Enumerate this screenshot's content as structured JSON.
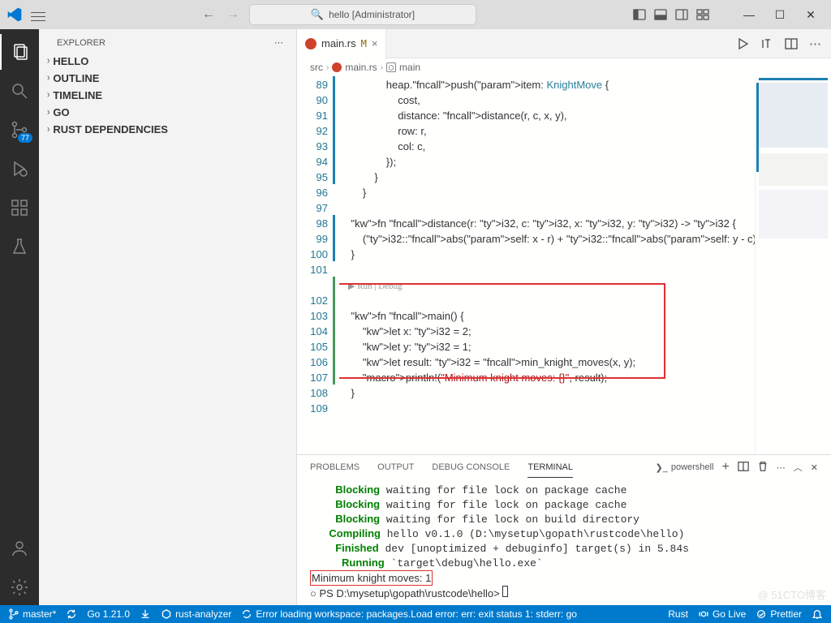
{
  "window": {
    "title": "hello [Administrator]"
  },
  "explorer": {
    "title": "EXPLORER",
    "sections": [
      "HELLO",
      "OUTLINE",
      "TIMELINE",
      "GO",
      "RUST DEPENDENCIES"
    ]
  },
  "source_control": {
    "badge": "77"
  },
  "tab": {
    "filename": "main.rs",
    "dirty_marker": "M",
    "close": "×"
  },
  "breadcrumbs": {
    "src": "src",
    "file": "main.rs",
    "symbol": "main"
  },
  "run_lens": "▶ Run | Debug",
  "code": {
    "first_line_no": 89,
    "lines": [
      "                heap.push(item: KnightMove {",
      "                    cost,",
      "                    distance: distance(r, c, x, y),",
      "                    row: r,",
      "                    col: c,",
      "                });",
      "            }",
      "        }",
      "",
      "    fn distance(r: i32, c: i32, x: i32, y: i32) -> i32 {",
      "        (i32::abs(self: x - r) + i32::abs(self: y - c)) / 3",
      "    }",
      "",
      "",
      "    fn main() {",
      "        let x: i32 = 2;",
      "        let y: i32 = 1;",
      "        let result: i32 = min_knight_moves(x, y);",
      "        println!(\"Minimum knight moves: {}\", result);",
      "    }",
      ""
    ]
  },
  "panel": {
    "tabs": {
      "problems": "PROBLEMS",
      "output": "OUTPUT",
      "debug": "DEBUG CONSOLE",
      "terminal": "TERMINAL"
    },
    "shell": "powershell"
  },
  "terminal": {
    "lines": [
      {
        "cls": "tgreen",
        "indent": "    ",
        "label": "Blocking",
        "rest": " waiting for file lock on package cache"
      },
      {
        "cls": "tgreen",
        "indent": "    ",
        "label": "Blocking",
        "rest": " waiting for file lock on package cache"
      },
      {
        "cls": "tgreen",
        "indent": "    ",
        "label": "Blocking",
        "rest": " waiting for file lock on build directory"
      },
      {
        "cls": "tgreen",
        "indent": "   ",
        "label": "Compiling",
        "rest": " hello v0.1.0 (D:\\mysetup\\gopath\\rustcode\\hello)"
      },
      {
        "cls": "tgreen",
        "indent": "    ",
        "label": "Finished",
        "rest": " dev [unoptimized + debuginfo] target(s) in 5.84s"
      },
      {
        "cls": "tgreen",
        "indent": "     ",
        "label": "Running",
        "rest": " `target\\debug\\hello.exe`"
      }
    ],
    "output": "Minimum knight moves: 1",
    "prompt_circle": "○",
    "prompt": "PS D:\\mysetup\\gopath\\rustcode\\hello> "
  },
  "statusbar": {
    "branch": "master*",
    "go": "Go 1.21.0",
    "rust_analyzer": "rust-analyzer",
    "error": "Error loading workspace: packages.Load error: err: exit status 1: stderr: go",
    "lang": "Rust",
    "go_live": "Go Live",
    "prettier": "Prettier"
  },
  "watermark": "@ 51CTO博客"
}
